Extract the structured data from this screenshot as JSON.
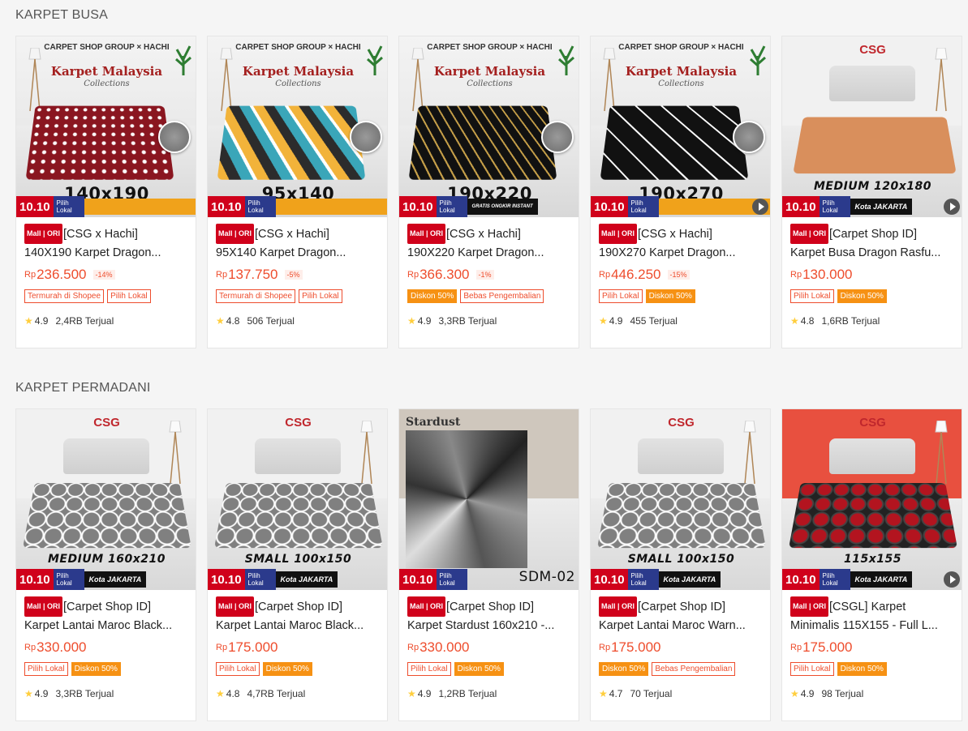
{
  "sections": [
    {
      "title": "KARPET BUSA",
      "products": [
        {
          "image": {
            "brand": "CARPET SHOP GROUP × HACHI",
            "headline": "Karpet Malaysia",
            "sub": "Collections",
            "size": "140x190",
            "badge_mid": "",
            "style": "dragon",
            "rug": "#8a1620"
          },
          "mall": "Mall | ORI",
          "title": "[CSG x Hachi] 140X190 Karpet Dragon...",
          "title_line1": "[CSG x Hachi]",
          "title_line2": "140X190 Karpet Dragon...",
          "price_rp": "Rp",
          "price": "236.500",
          "discount": "-14%",
          "tags": [
            "Termurah di Shopee",
            "Pilih Lokal"
          ],
          "rating": "4.9",
          "sold": "2,4RB Terjual"
        },
        {
          "image": {
            "brand": "CARPET SHOP GROUP × HACHI",
            "headline": "Karpet Malaysia",
            "sub": "Collections",
            "size": "95x140",
            "badge_mid": "",
            "style": "chevron-color",
            "rug": "#f2b33a"
          },
          "mall": "Mall | ORI",
          "title_line1": "[CSG x Hachi]",
          "title_line2": "95X140 Karpet Dragon...",
          "price_rp": "Rp",
          "price": "137.750",
          "discount": "-5%",
          "tags": [
            "Termurah di Shopee",
            "Pilih Lokal"
          ],
          "rating": "4.8",
          "sold": "506 Terjual"
        },
        {
          "image": {
            "brand": "CARPET SHOP GROUP × HACHI",
            "headline": "Karpet Malaysia",
            "sub": "Collections",
            "size": "190x220",
            "badge_mid": "GRATIS ONGKIR INSTANT",
            "style": "chevron-gold",
            "rug": "#1a1a1a"
          },
          "mall": "Mall | ORI",
          "title_line1": "[CSG x Hachi]",
          "title_line2": "190X220 Karpet Dragon...",
          "price_rp": "Rp",
          "price": "366.300",
          "discount": "-1%",
          "tags": [
            "Diskon 50%",
            "Bebas Pengembalian"
          ],
          "tag_styles": [
            "orange",
            ""
          ],
          "rating": "4.9",
          "sold": "3,3RB Terjual"
        },
        {
          "image": {
            "brand": "CARPET SHOP GROUP × HACHI",
            "headline": "Karpet Malaysia",
            "sub": "Collections",
            "size": "190x270",
            "badge_mid": "",
            "style": "herringbone",
            "rug": "#111"
          },
          "mall": "Mall | ORI",
          "title_line1": "[CSG x Hachi]",
          "title_line2": "190X270 Karpet Dragon...",
          "price_rp": "Rp",
          "price": "446.250",
          "discount": "-15%",
          "tags": [
            "Pilih Lokal",
            "Diskon 50%"
          ],
          "tag_styles": [
            "",
            "orange"
          ],
          "rating": "4.9",
          "sold": "455 Terjual"
        },
        {
          "image": {
            "brand": "CSG",
            "headline": "",
            "sub": "",
            "size": "MEDIUM 120x180",
            "badge_mid": "Kota JAKARTA",
            "style": "plain-orange",
            "rug": "#d98f5c"
          },
          "mall": "Mall | ORI",
          "title_line1": "[Carpet Shop ID]",
          "title_line2": "Karpet Busa Dragon Rasfu...",
          "price_rp": "Rp",
          "price": "130.000",
          "discount": "",
          "tags": [
            "Pilih Lokal",
            "Diskon 50%"
          ],
          "tag_styles": [
            "",
            "orange"
          ],
          "rating": "4.8",
          "sold": "1,6RB Terjual"
        }
      ]
    },
    {
      "title": "KARPET PERMADANI",
      "products": [
        {
          "image": {
            "brand": "CSG",
            "headline": "",
            "sub": "",
            "size": "MEDIUM 160x210",
            "badge_mid": "Kota JAKARTA",
            "style": "maroc",
            "rug": "#7a7a7a"
          },
          "mall": "Mall | ORI",
          "title_line1": "[Carpet Shop ID]",
          "title_line2": "Karpet Lantai Maroc Black...",
          "price_rp": "Rp",
          "price": "330.000",
          "discount": "",
          "tags": [
            "Pilih Lokal",
            "Diskon 50%"
          ],
          "tag_styles": [
            "",
            "orange"
          ],
          "rating": "4.9",
          "sold": "3,3RB Terjual"
        },
        {
          "image": {
            "brand": "CSG",
            "headline": "",
            "sub": "",
            "size": "SMALL 100x150",
            "badge_mid": "Kota JAKARTA",
            "style": "maroc",
            "rug": "#7a7a7a"
          },
          "mall": "Mall | ORI",
          "title_line1": "[Carpet Shop ID]",
          "title_line2": "Karpet Lantai Maroc Black...",
          "price_rp": "Rp",
          "price": "175.000",
          "discount": "",
          "tags": [
            "Pilih Lokal",
            "Diskon 50%"
          ],
          "tag_styles": [
            "",
            "orange"
          ],
          "rating": "4.8",
          "sold": "4,7RB Terjual"
        },
        {
          "image": {
            "brand": "Stardust",
            "headline": "",
            "sub": "",
            "size": "SDM-02",
            "badge_mid": "",
            "style": "stardust",
            "rug": "#444"
          },
          "mall": "Mall | ORI",
          "title_line1": "[Carpet Shop ID]",
          "title_line2": "Karpet Stardust 160x210 -...",
          "price_rp": "Rp",
          "price": "330.000",
          "discount": "",
          "tags": [
            "Pilih Lokal",
            "Diskon 50%"
          ],
          "tag_styles": [
            "",
            "orange"
          ],
          "rating": "4.9",
          "sold": "1,2RB Terjual"
        },
        {
          "image": {
            "brand": "CSG",
            "headline": "",
            "sub": "",
            "size": "SMALL 100x150",
            "badge_mid": "Kota JAKARTA",
            "style": "maroc",
            "rug": "#7a7a7a"
          },
          "mall": "Mall | ORI",
          "title_line1": "[Carpet Shop ID]",
          "title_line2": "Karpet Lantai Maroc Warn...",
          "price_rp": "Rp",
          "price": "175.000",
          "discount": "",
          "tags": [
            "Diskon 50%",
            "Bebas Pengembalian"
          ],
          "tag_styles": [
            "orange",
            ""
          ],
          "rating": "4.7",
          "sold": "70 Terjual"
        },
        {
          "image": {
            "brand": "CSG",
            "headline": "",
            "sub": "",
            "size": "115x155",
            "badge_mid": "Kota JAKARTA",
            "style": "hex-red",
            "rug": "#8a1620"
          },
          "mall": "Mall | ORI",
          "title_line1": "[CSGL] Karpet",
          "title_line2": "Minimalis 115X155 - Full L...",
          "price_rp": "Rp",
          "price": "175.000",
          "discount": "",
          "tags": [
            "Pilih Lokal",
            "Diskon 50%"
          ],
          "tag_styles": [
            "",
            "orange"
          ],
          "rating": "4.9",
          "sold": "98 Terjual"
        }
      ]
    }
  ],
  "badges": {
    "event": "10.10",
    "pilih": "Pilih Lokal"
  }
}
